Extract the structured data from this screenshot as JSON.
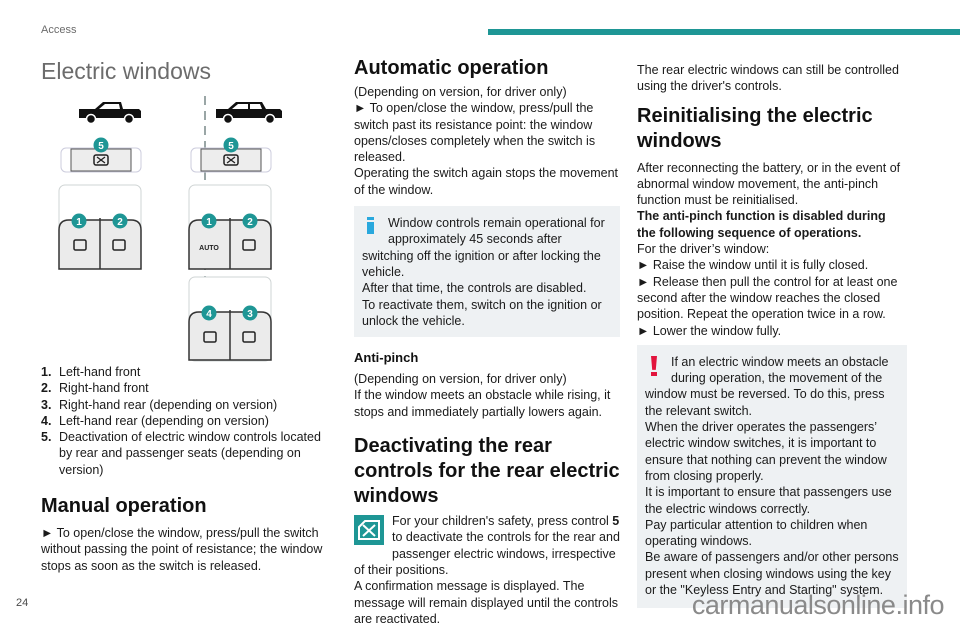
{
  "header": {
    "section": "Access",
    "accent_color": "#1e9695"
  },
  "footer": {
    "page_number": "24",
    "watermark": "carmanualsonline.info"
  },
  "column1": {
    "title": "Electric windows",
    "figure": {
      "left_variant": {
        "vehicle": "single-cab pickup",
        "deactivation_label": "5",
        "front_labels": [
          "1",
          "2"
        ]
      },
      "right_variant": {
        "vehicle": "double-cab pickup",
        "deactivation_label": "5",
        "front_labels": [
          "1",
          "2"
        ],
        "front_left_text": "AUTO",
        "rear_labels": [
          "4",
          "3"
        ]
      }
    },
    "legend": [
      {
        "num": "1.",
        "text": "Left-hand front"
      },
      {
        "num": "2.",
        "text": "Right-hand front"
      },
      {
        "num": "3.",
        "text": "Right-hand rear (depending on version)"
      },
      {
        "num": "4.",
        "text": "Left-hand rear (depending on version)"
      },
      {
        "num": "5.",
        "text": "Deactivation of electric window controls located by rear and passenger seats (depending on version)"
      }
    ],
    "manual": {
      "heading": "Manual operation",
      "body": "► To open/close the window, press/pull the switch without passing the point of resistance; the window stops as soon as the switch is released."
    }
  },
  "column2": {
    "automatic": {
      "heading": "Automatic operation",
      "line1": "(Depending on version, for driver only)",
      "line2": "► To open/close the window, press/pull the switch past its resistance point: the window opens/closes completely when the switch is released.",
      "line3": "Operating the switch again stops the movement of the window."
    },
    "info_note": {
      "text1": "Window controls remain operational for approximately 45 seconds after switching off the ignition or after locking the vehicle.",
      "text2": "After that time, the controls are disabled.",
      "text3": "To reactivate them, switch on the ignition or unlock the vehicle."
    },
    "antipinch": {
      "heading": "Anti-pinch",
      "line1": "(Depending on version, for driver only)",
      "line2": "If the window meets an obstacle while rising, it stops and immediately partially lowers again."
    },
    "deactivating": {
      "heading": "Deactivating the rear controls for the rear electric windows",
      "text_pre": "For your children's safety, press control ",
      "control_num": "5",
      "text_post": " to deactivate the controls for the rear and passenger electric windows, irrespective of their positions.",
      "text2": "A confirmation message is displayed. The message will remain displayed until the controls are reactivated."
    }
  },
  "column3": {
    "intro": "The rear electric windows can still be controlled using the driver's controls.",
    "reinit": {
      "heading": "Reinitialising the electric windows",
      "p1": "After reconnecting the battery, or in the event of abnormal window movement, the anti-pinch function must be reinitialised.",
      "p2_bold": "The anti-pinch function is disabled during the following sequence of operations.",
      "p3": "For the driver’s window:",
      "step1": "► Raise the window until it is fully closed.",
      "step2": "► Release then pull the control for at least one second after the window reaches the closed position. Repeat the operation twice in a row.",
      "step3": "► Lower the window fully."
    },
    "warning": {
      "t1": "If an electric window meets an obstacle during operation, the movement of the window must be reversed. To do this, press the relevant switch.",
      "t2": "When the driver operates the passengers’ electric window switches, it is important to ensure that nothing can prevent the window from closing properly.",
      "t3": "It is important to ensure that passengers use the electric windows correctly.",
      "t4": "Pay particular attention to children when operating windows.",
      "t5": "Be aware of passengers and/or other persons present when closing windows using the key or the \"Keyless Entry and Starting\" system."
    }
  }
}
